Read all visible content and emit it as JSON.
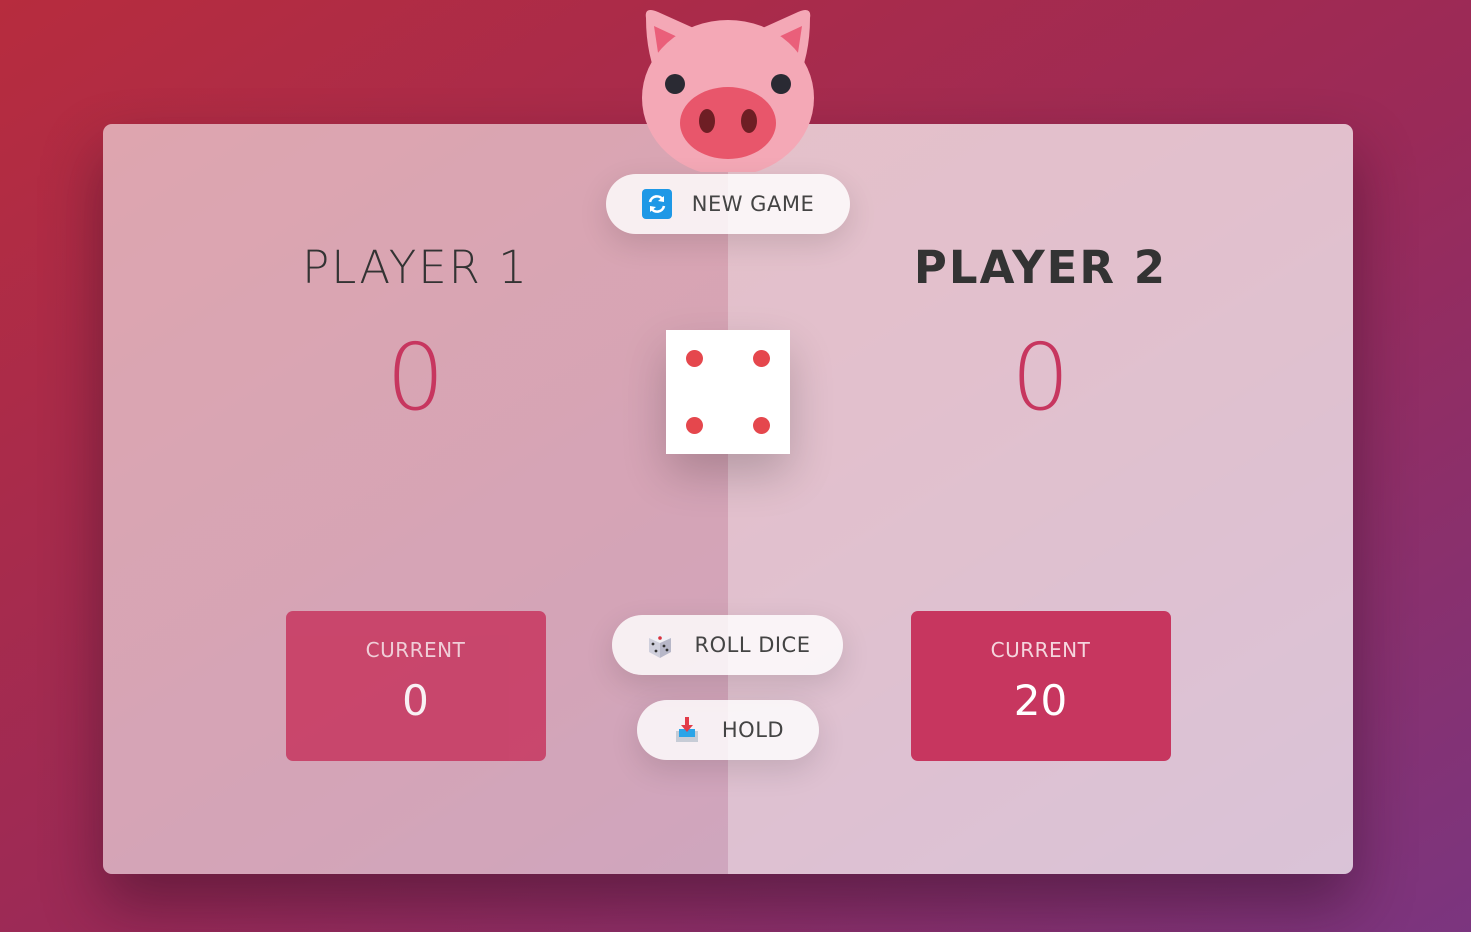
{
  "colors": {
    "accent": "#c7365f",
    "pip": "#e5474d",
    "background_top": "#b72c3e",
    "background_bottom": "#7b357f"
  },
  "controls": {
    "new_game": {
      "label": "NEW GAME",
      "icon": "refresh-icon"
    },
    "roll_dice": {
      "label": "ROLL DICE",
      "icon": "dice-icon"
    },
    "hold": {
      "label": "HOLD",
      "icon": "inbox-tray-icon"
    }
  },
  "logo": {
    "icon": "pig-face-icon"
  },
  "dice": {
    "value": 4
  },
  "players": [
    {
      "name": "PLAYER 1",
      "score": "0",
      "current_label": "CURRENT",
      "current_score": "0",
      "active": false
    },
    {
      "name": "PLAYER 2",
      "score": "0",
      "current_label": "CURRENT",
      "current_score": "20",
      "active": true
    }
  ]
}
